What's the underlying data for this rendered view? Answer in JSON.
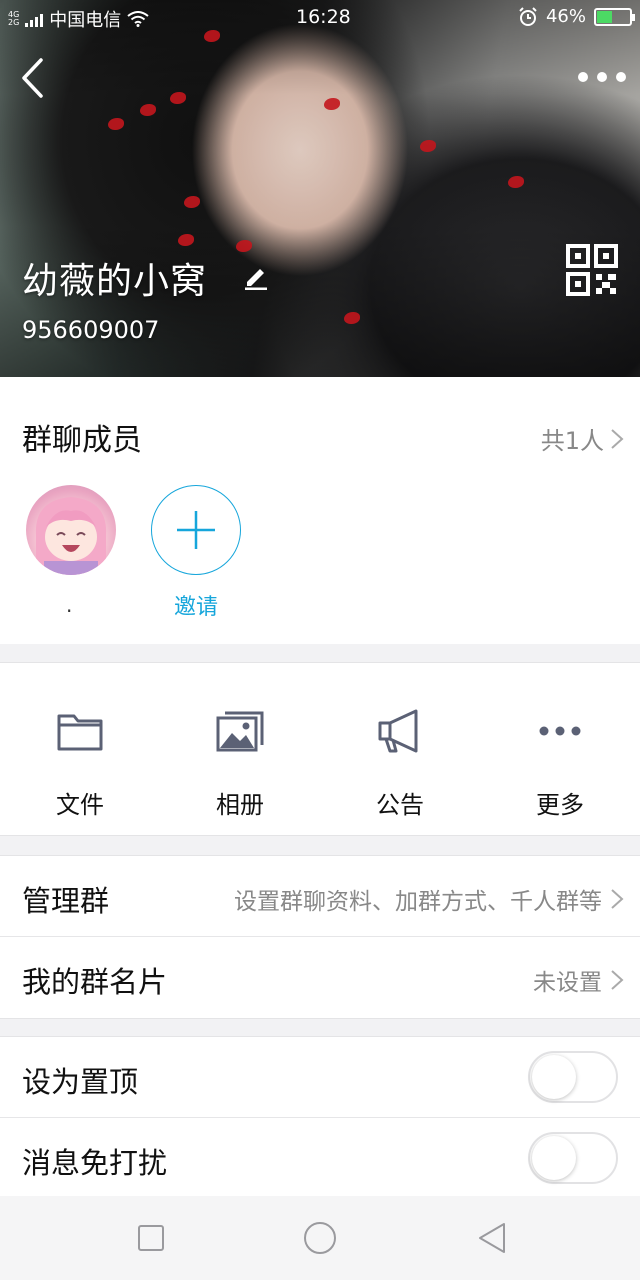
{
  "status_bar": {
    "carrier": "中国电信",
    "time": "16:28",
    "battery": "46%",
    "network_tags": [
      "4G",
      "2G"
    ]
  },
  "header": {
    "group_name": "幼薇的小窝",
    "group_id": "956609007",
    "icons": [
      "back-icon",
      "more-icon",
      "edit-icon",
      "qr-code-icon"
    ]
  },
  "members": {
    "title": "群聊成员",
    "count_label": "共1人",
    "list": [
      {
        "name": "."
      }
    ],
    "invite_label": "邀请"
  },
  "shortcuts": [
    {
      "label": "文件",
      "icon": "folder-icon"
    },
    {
      "label": "相册",
      "icon": "album-icon"
    },
    {
      "label": "公告",
      "icon": "megaphone-icon"
    },
    {
      "label": "更多",
      "icon": "more-dots-icon"
    }
  ],
  "manage": {
    "label": "管理群",
    "value": "设置群聊资料、加群方式、千人群等"
  },
  "card": {
    "label": "我的群名片",
    "value": "未设置"
  },
  "toggles": {
    "pin_label": "设为置顶",
    "pin_on": false,
    "mute_label": "消息免打扰",
    "mute_on": false
  },
  "colors": {
    "accent": "#16a6db",
    "icon_gray": "#5b6175",
    "secondary_text": "#888888"
  }
}
